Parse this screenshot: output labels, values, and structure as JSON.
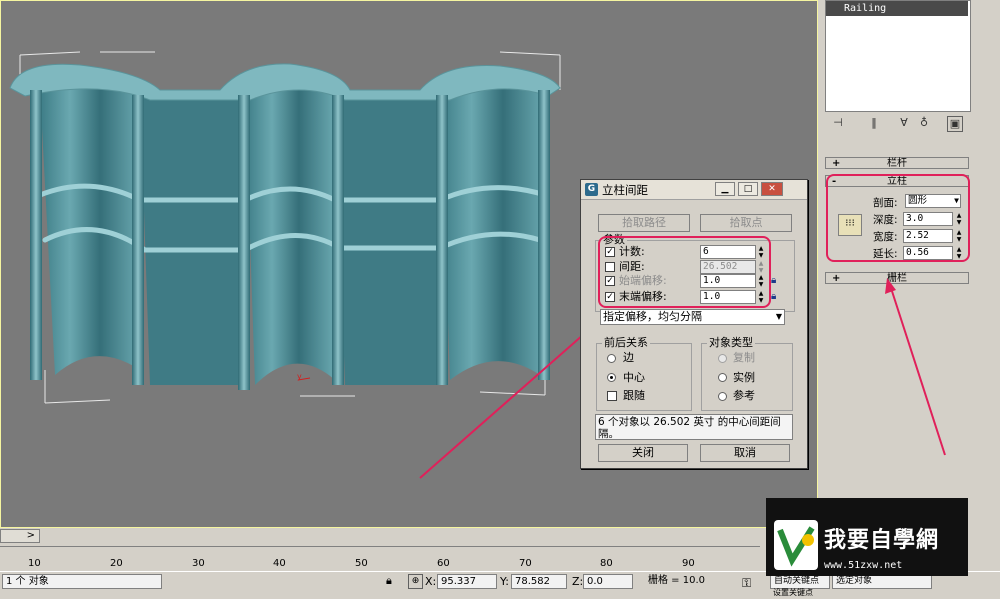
{
  "object_list": {
    "selected_item": "Railing"
  },
  "command_panel": {
    "rollout_railing": "栏杆",
    "rollout_post": "立柱",
    "rollout_fence": "栅栏",
    "plus_sign": "+",
    "minus_sign": "-",
    "profile_label": "剖面:",
    "profile_value": "圆形",
    "depth_label": "深度:",
    "depth_value": "3.0",
    "width_label": "宽度:",
    "width_value": "2.52",
    "extension_label": "延长:",
    "extension_value": "0.56"
  },
  "dialog": {
    "title": "立柱间距",
    "pick_path": "拾取路径",
    "pick_points": "拾取点",
    "params_group": "参数",
    "count_label": "计数:",
    "count_value": "6",
    "count_checked": true,
    "spacing_label": "间距:",
    "spacing_value": "26.502",
    "spacing_checked": false,
    "start_offset_label": "始端偏移:",
    "start_offset_value": "1.0",
    "start_offset_checked": true,
    "end_offset_label": "末端偏移:",
    "end_offset_value": "1.0",
    "end_offset_checked": true,
    "mode_value": "指定偏移，均匀分隔",
    "context_group": "前后关系",
    "context_options": [
      "边",
      "中心",
      "跟随"
    ],
    "type_group": "对象类型",
    "type_options": [
      "复制",
      "实例",
      "参考"
    ],
    "info_text": "6 个对象以 26.502 英寸 的中心间距间隔。",
    "close_button": "关闭",
    "cancel_button": "取消"
  },
  "timeline": {
    "slider_arrow": ">",
    "ticks": [
      "10",
      "20",
      "30",
      "40",
      "50",
      "60",
      "70",
      "80",
      "90"
    ]
  },
  "status_bar": {
    "selection": "1 个 对象",
    "x_label": "X:",
    "x_value": "95.337",
    "y_label": "Y:",
    "y_value": "78.582",
    "z_label": "Z:",
    "z_value": "0.0",
    "grid": "栅格 = 10.0",
    "auto_key": "自动关键点",
    "selected": "选定对象",
    "set_key": "设置关键点"
  },
  "watermark": {
    "title": "我要自學網",
    "url": "www.51zxw.net"
  },
  "colors": {
    "annotation": "#e0205a",
    "viewport": "#7a7a7a",
    "model": "#4f8f99",
    "title_icon": "#2d6b8d"
  }
}
